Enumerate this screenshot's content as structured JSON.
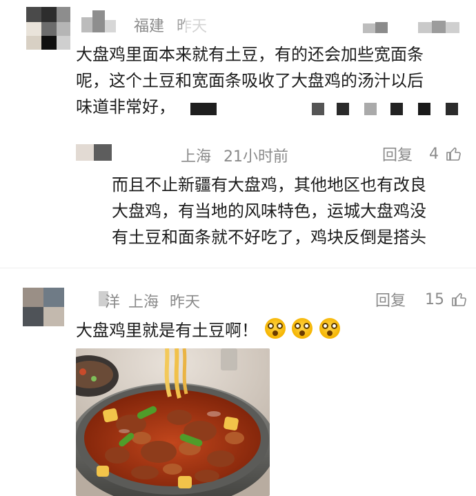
{
  "comment1": {
    "location": "福建",
    "time_partial": "昨天",
    "body_line1": "大盘鸡里面本来就有土豆，有的还会加些宽面条",
    "body_line2": "呢，这个土豆和宽面条吸收了大盘鸡的汤汁以后",
    "body_line3": "味道非常好，"
  },
  "reply1": {
    "location": "上海",
    "time": "21小时前",
    "reply_label": "回复",
    "likes": "4",
    "body_line1": "而且不止新疆有大盘鸡，其他地区也有改良",
    "body_line2": "大盘鸡，有当地的风味特色，运城大盘鸡没",
    "body_line3": "有土豆和面条就不好吃了，鸡块反倒是搭头"
  },
  "comment2": {
    "name_partial": "洋",
    "location": "上海",
    "time": "昨天",
    "reply_label": "回复",
    "likes": "15",
    "body": "大盘鸡里就是有土豆啊！"
  },
  "icons": {
    "like": "thumbs-up-icon",
    "emoji": "astonished-face-emoji"
  },
  "colors": {
    "meta_text": "#8a8a8a",
    "body_text": "#1c1c1c",
    "background": "#ffffff"
  }
}
